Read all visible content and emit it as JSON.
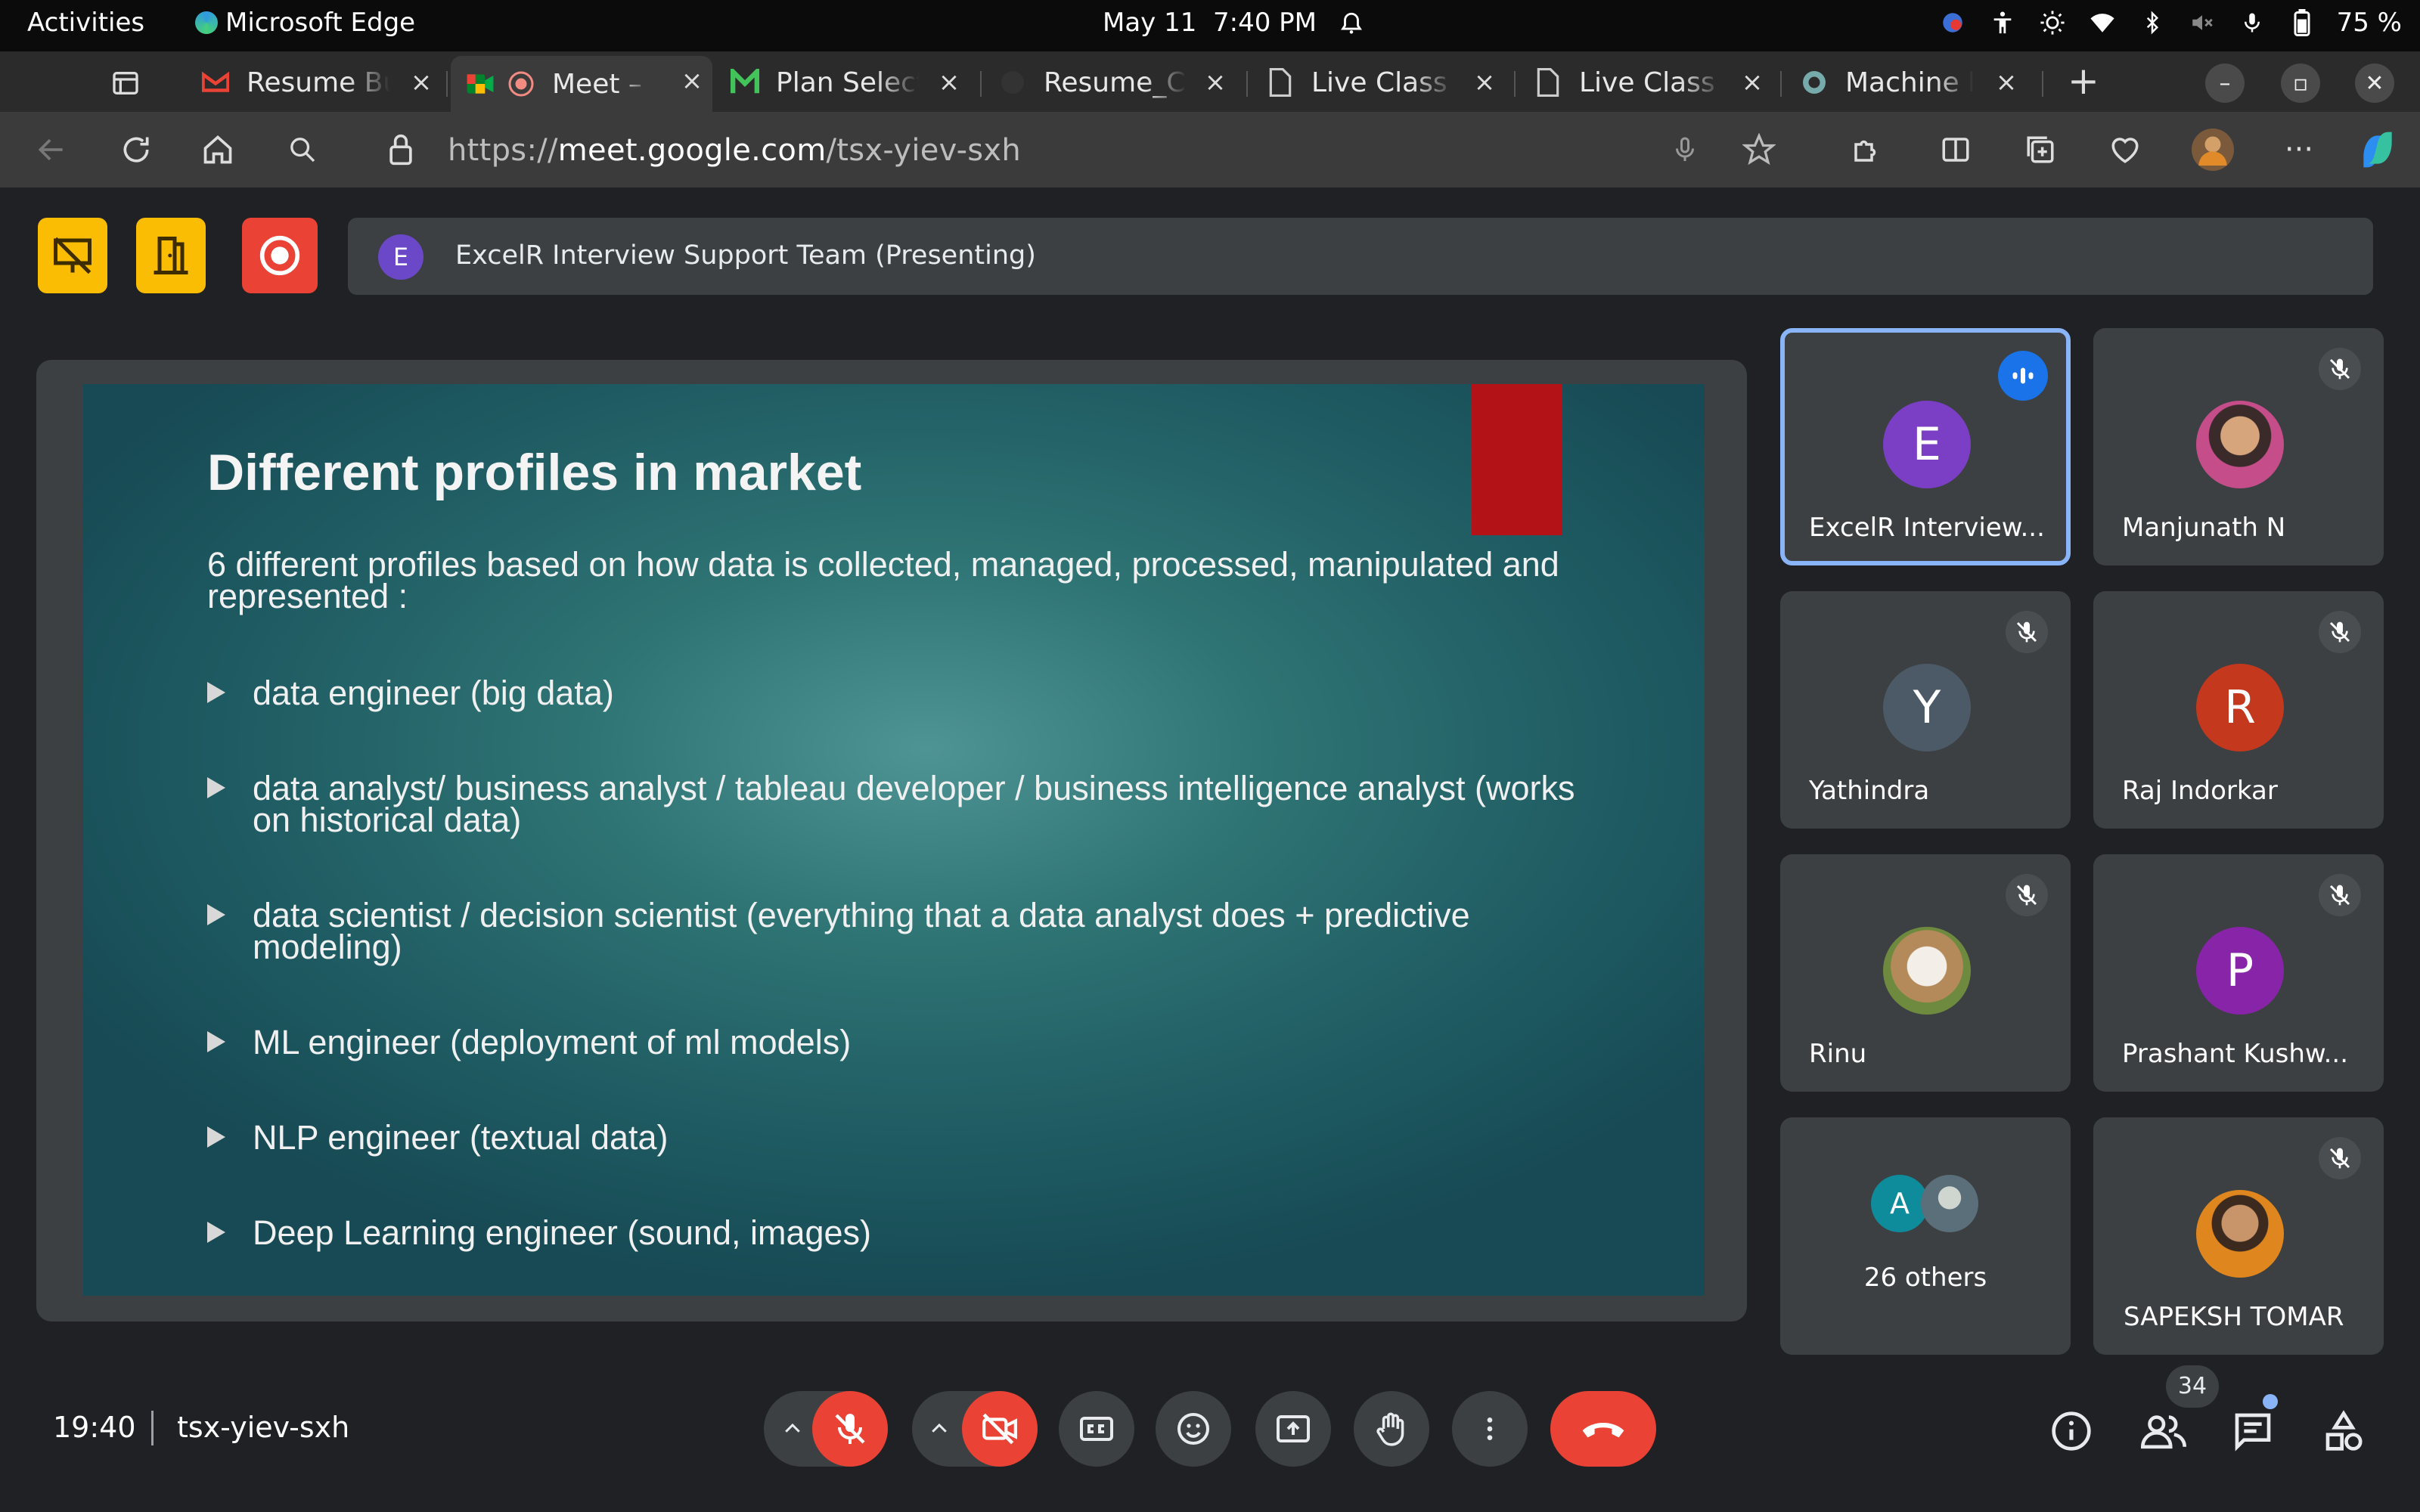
{
  "system": {
    "activities": "Activities",
    "app_name": "Microsoft Edge",
    "date": "May 11",
    "time": "7:40 PM",
    "battery": "75 %"
  },
  "tabs": [
    {
      "label": "Resume Builder",
      "favicon": "gmail-icon"
    },
    {
      "label": "Meet – tsx-yiev-sxh",
      "favicon": "meet-icon",
      "active": true
    },
    {
      "label": "Plan Selection",
      "favicon": "m-logo-icon"
    },
    {
      "label": "Resume_Clean",
      "favicon": "github-icon"
    },
    {
      "label": "Live Class Recording",
      "favicon": "page-icon"
    },
    {
      "label": "Live Class Recording",
      "favicon": "page-icon"
    },
    {
      "label": "Machine learning",
      "favicon": "openai-icon"
    }
  ],
  "address": {
    "scheme": "https://",
    "host": "meet.google.com",
    "path": "/tsx-yiev-sxh"
  },
  "presenting": {
    "avatar_letter": "E",
    "text": "ExcelR Interview Support Team (Presenting)"
  },
  "slide": {
    "title": "Different profiles in market",
    "intro": "6 different profiles based on how data is collected, managed, processed, manipulated and represented :",
    "bullets": [
      "data engineer (big data)",
      "data analyst/ business analyst / tableau developer / business intelligence analyst (works on historical data)",
      "data scientist / decision scientist (everything that a data analyst does + predictive modeling)",
      "ML engineer (deployment of ml models)",
      "NLP engineer (textual data)",
      "Deep Learning engineer (sound, images)"
    ]
  },
  "participants": [
    {
      "name": "ExcelR Interview...",
      "letter": "E",
      "color": "#7b3fc6",
      "speaking": true
    },
    {
      "name": "Manjunath N",
      "letter": "",
      "color": "#8a5a7a",
      "muted": true
    },
    {
      "name": "Yathindra",
      "letter": "Y",
      "color": "#4b5a66",
      "muted": true
    },
    {
      "name": "Raj Indorkar",
      "letter": "R",
      "color": "#c4391e",
      "muted": true
    },
    {
      "name": "Rinu",
      "letter": "",
      "color": "#b79a7a",
      "muted": true
    },
    {
      "name": "Prashant Kushw...",
      "letter": "P",
      "color": "#8824a8",
      "muted": true
    },
    {
      "name": "26 others",
      "letter": "A",
      "color": "#0f8c9c"
    },
    {
      "name": "SAPEKSH TOMAR",
      "letter": "",
      "color": "#c57a22",
      "muted": true
    }
  ],
  "bottom": {
    "time": "19:40",
    "meeting_code": "tsx-yiev-sxh",
    "people_count": "34"
  },
  "colors": {
    "meet_bg": "#202124",
    "tile_bg": "#3c4043",
    "end_call": "#ea4335",
    "speaking_border": "#8ab4f8",
    "slide_accent": "#b31217"
  }
}
